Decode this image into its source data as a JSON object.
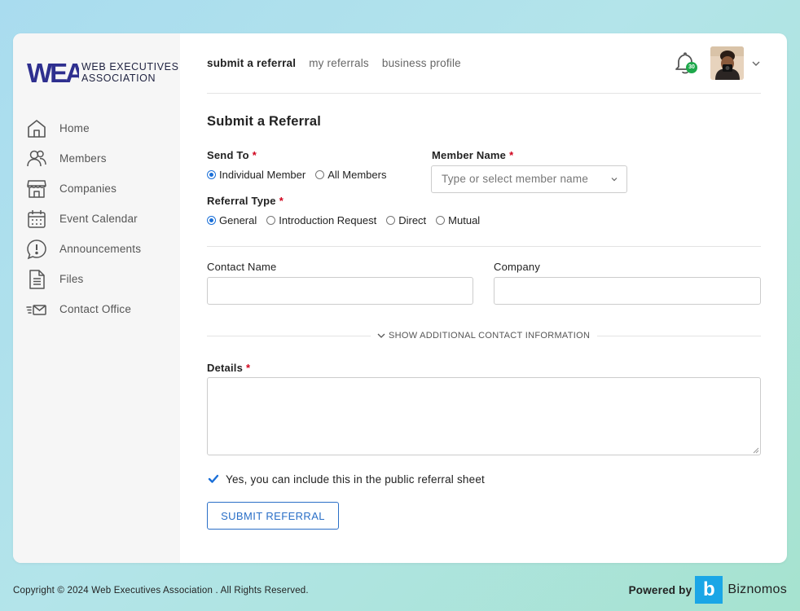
{
  "brand": {
    "logo_letters": "WEA",
    "name_line1": "WEB EXECUTIVES",
    "name_line2": "ASSOCIATION",
    "color": "#2e2f8f"
  },
  "sidebar": {
    "items": [
      {
        "label": "Home",
        "icon": "home-icon"
      },
      {
        "label": "Members",
        "icon": "members-icon"
      },
      {
        "label": "Companies",
        "icon": "storefront-icon"
      },
      {
        "label": "Event Calendar",
        "icon": "calendar-icon"
      },
      {
        "label": "Announcements",
        "icon": "announcement-icon"
      },
      {
        "label": "Files",
        "icon": "file-icon"
      },
      {
        "label": "Contact Office",
        "icon": "envelope-icon"
      }
    ]
  },
  "topnav": {
    "tabs": [
      {
        "label": "submit a referral",
        "active": true
      },
      {
        "label": "my referrals",
        "active": false
      },
      {
        "label": "business profile",
        "active": false
      }
    ],
    "notification_count": "30"
  },
  "form": {
    "title": "Submit a Referral",
    "send_to": {
      "label": "Send To",
      "required": "*",
      "options": [
        "Individual Member",
        "All Members"
      ],
      "selected": "Individual Member"
    },
    "member_name": {
      "label": "Member Name",
      "required": "*",
      "placeholder": "Type or select member name"
    },
    "referral_type": {
      "label": "Referral Type",
      "required": "*",
      "options": [
        "General",
        "Introduction Request",
        "Direct",
        "Mutual"
      ],
      "selected": "General"
    },
    "contact_name": {
      "label": "Contact Name",
      "value": ""
    },
    "company": {
      "label": "Company",
      "value": ""
    },
    "show_additional": "SHOW ADDITIONAL CONTACT INFORMATION",
    "details": {
      "label": "Details",
      "required": "*",
      "value": ""
    },
    "public_checkbox": {
      "label": "Yes, you can include this in the public referral sheet",
      "checked": true
    },
    "submit_label": "SUBMIT REFERRAL"
  },
  "footer": {
    "copyright": "Copyright © 2024 Web Executives Association . All Rights Reserved.",
    "powered_by": "Powered by",
    "provider_logo_letter": "b",
    "provider_name": "Biznomos"
  },
  "colors": {
    "accent": "#1a6fd8",
    "required": "#d0021b",
    "badge": "#1ea84b",
    "provider": "#1aa6e6"
  }
}
